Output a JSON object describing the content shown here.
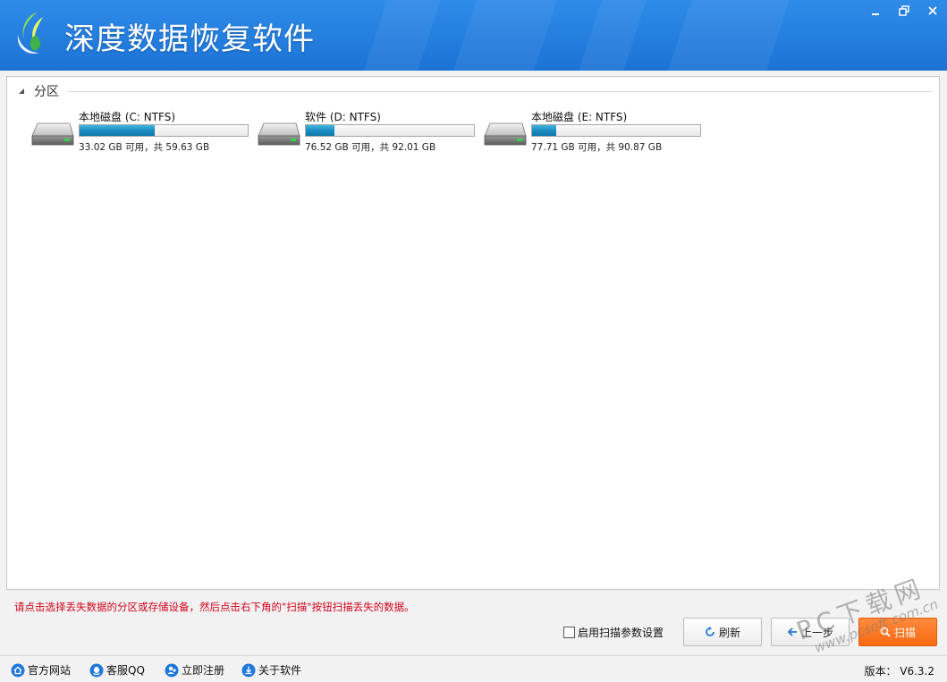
{
  "app": {
    "title": "深度数据恢复软件",
    "colors": {
      "title_bar": "#1f78db",
      "hint": "#d0021b",
      "scan_button": "#f97316",
      "drive_bar": "#1b8cc2"
    }
  },
  "window_controls": {
    "icons": [
      "minimize-icon",
      "restore-icon",
      "close-icon"
    ]
  },
  "section": {
    "label": "分区",
    "collapsed": false
  },
  "drives": [
    {
      "name": "本地磁盘 (C: NTFS)",
      "info": "33.02 GB 可用，共 59.63 GB",
      "used_fraction": 0.446
    },
    {
      "name": "软件 (D: NTFS)",
      "info": "76.52 GB 可用，共 92.01 GB",
      "used_fraction": 0.168
    },
    {
      "name": "本地磁盘 (E: NTFS)",
      "info": "77.71 GB 可用，共 90.87 GB",
      "used_fraction": 0.145
    }
  ],
  "hint": "请点击选择丢失数据的分区或存储设备，然后点击右下角的\"扫描\"按钮扫描丢失的数据。",
  "options": {
    "scan_params_label": "启用扫描参数设置",
    "scan_params_checked": false
  },
  "buttons": {
    "refresh": "刷新",
    "back": "上一步",
    "scan": "扫描"
  },
  "watermark": {
    "big": "PC下载网",
    "small": "www.pcsoft.com.cn"
  },
  "statusbar": {
    "links": [
      {
        "label": "官方网站",
        "icon": "home-icon"
      },
      {
        "label": "客服QQ",
        "icon": "qq-icon"
      },
      {
        "label": "立即注册",
        "icon": "user-add-icon"
      },
      {
        "label": "关于软件",
        "icon": "info-download-icon"
      }
    ],
    "version": "版本： V6.3.2"
  }
}
